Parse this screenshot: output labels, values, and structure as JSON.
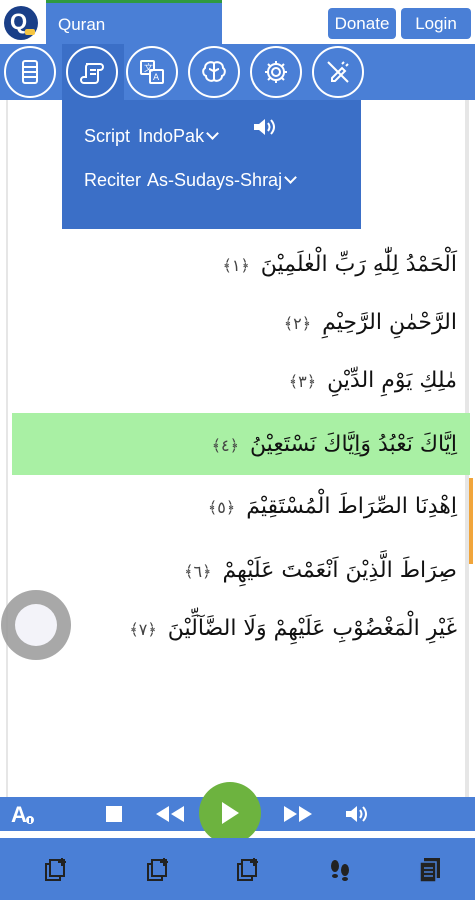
{
  "header": {
    "app_title": "Quran",
    "donate_label": "Donate",
    "login_label": "Login"
  },
  "toolbar": {
    "tools": [
      "list-icon",
      "script-icon",
      "translate-icon",
      "brain-icon",
      "gear-icon",
      "no-edit-icon"
    ],
    "active_tool": "script-icon"
  },
  "settings_popup": {
    "script_label": "Script",
    "script_value": "IndoPak",
    "reciter_label": "Reciter",
    "reciter_value": "As-Sudays-Shraj"
  },
  "verses": [
    {
      "text": "اَلْحَمْدُ لِلّٰهِ رَبِّ الْعٰلَمِيْنَ",
      "num": "﴿١﴾"
    },
    {
      "text": "الرَّحْمٰنِ الرَّحِيْمِ",
      "num": "﴿٢﴾"
    },
    {
      "text": "مٰلِكِ يَوْمِ الدِّيْنِ",
      "num": "﴿٣﴾"
    },
    {
      "text": "اِيَّاكَ نَعْبُدُ وَاِيَّاكَ نَسْتَعِيْنُ",
      "num": "﴿٤﴾"
    },
    {
      "text": "اِهْدِنَا الصِّرَاطَ الْمُسْتَقِيْمَ",
      "num": "﴿٥﴾"
    },
    {
      "text": "صِرَاطَ الَّذِيْنَ اَنْعَمْتَ عَلَيْهِمْ",
      "num": "﴿٦﴾"
    },
    {
      "text": "غَيْرِ الْمَغْضُوْبِ عَلَيْهِمْ وَلَا الضَّآلِّيْنَ",
      "num": "﴿٧﴾"
    }
  ],
  "highlighted_verse": 4,
  "player": {
    "controls": [
      "font-size-icon",
      "stop-icon",
      "rewind-icon",
      "play-icon",
      "fast-forward-icon",
      "volume-icon"
    ]
  },
  "bottom_nav": {
    "items": [
      "bookmark-add-icon",
      "bookmark-add-icon-2",
      "bookmark-add-icon-3",
      "footprints-icon",
      "notes-icon"
    ]
  },
  "colors": {
    "primary": "#4a7fd6",
    "popup": "#3b6fc7",
    "highlight": "#a9f0a4",
    "play": "#6db33f",
    "accent_marker": "#f1a53b"
  }
}
